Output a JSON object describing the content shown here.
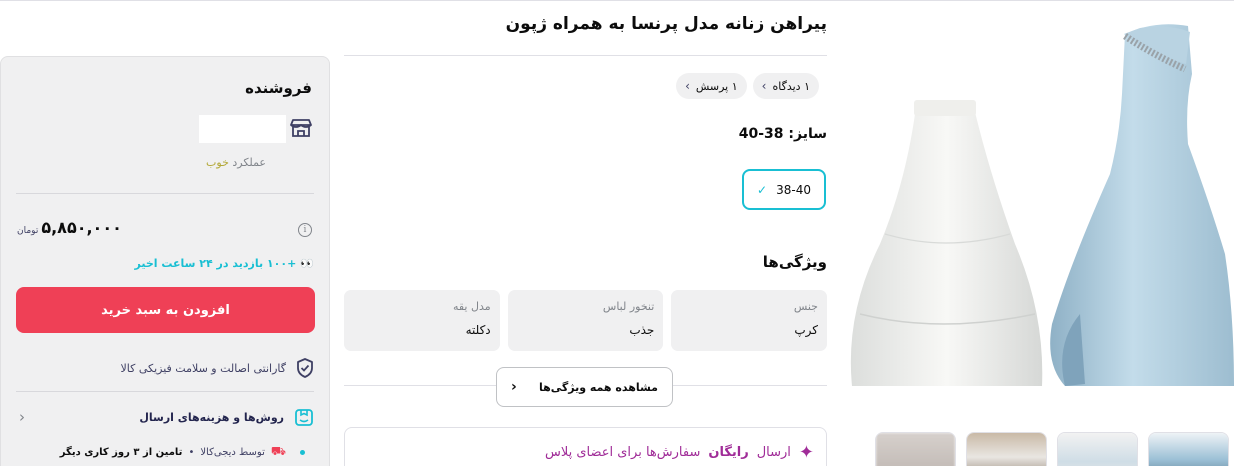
{
  "product": {
    "title": "پیراهن زنانه مدل پرنسا به همراه ژپون"
  },
  "chips": [
    {
      "label": "۱ دیدگاه"
    },
    {
      "label": "۱ پرسش"
    }
  ],
  "size": {
    "label": "سایز: 38-40",
    "option": "38-40"
  },
  "features": {
    "title": "ویژگی‌ها",
    "items": [
      {
        "key": "جنس",
        "value": "کرپ"
      },
      {
        "key": "تنخور لباس",
        "value": "جذب"
      },
      {
        "key": "مدل یقه",
        "value": "دکلته"
      }
    ],
    "see_all": "مشاهده همه ویژگی‌ها"
  },
  "free_shipping": {
    "prefix": "ارسال",
    "highlight": "رایگان",
    "suffix": "سفارش‌ها برای اعضای پلاس"
  },
  "seller": {
    "title": "فروشنده",
    "performance_label": "عملکرد",
    "performance_value": "خوب"
  },
  "price": {
    "amount": "۵,۸۵۰,۰۰۰",
    "currency": "تومان"
  },
  "visits": {
    "text": "+۱۰۰ بازدید در ۲۴ ساعت اخیر"
  },
  "buttons": {
    "add_to_cart": "افزودن به سبد خرید"
  },
  "guarantee": {
    "text": "گارانتی اصالت و سلامت فیزیکی کالا"
  },
  "shipping": {
    "title": "روش‌ها و هزینه‌های ارسال",
    "by": "توسط دیجی‌کالا",
    "eta": "تامین از ۳ روز کاری دیگر"
  },
  "colors": {
    "accent_red": "#ef4056",
    "accent_cyan": "#19bfd3",
    "plus_purple": "#a02c98",
    "good_yellow": "#b3a838"
  }
}
